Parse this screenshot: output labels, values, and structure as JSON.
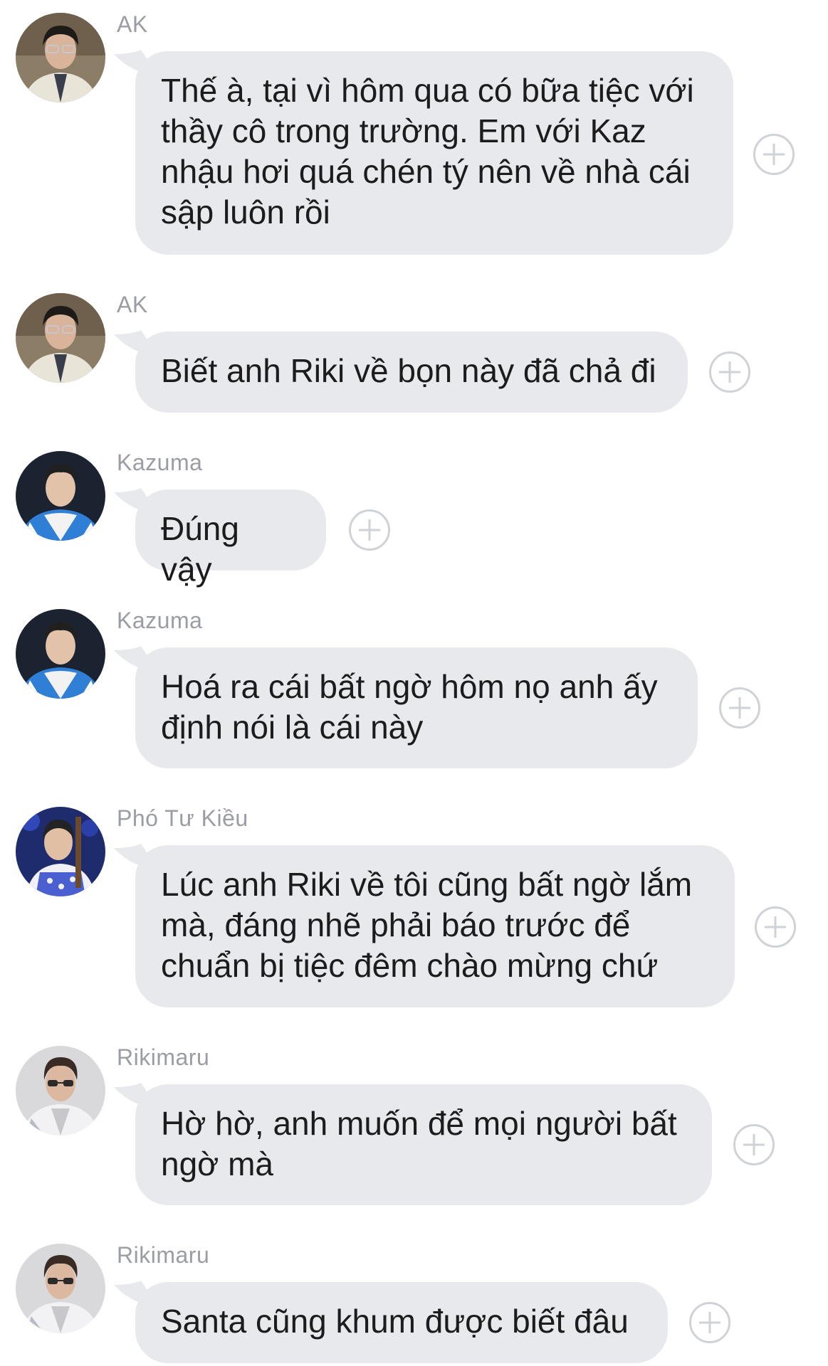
{
  "messages": [
    {
      "sender": "AK",
      "avatar_icon": "avatar-ak",
      "text": "Thế à, tại vì hôm qua có bữa tiệc với\nthầy cô trong trường. Em với Kaz\nnhậu hơi quá chén tý nên về nhà cái\nsập luôn rồi"
    },
    {
      "sender": "AK",
      "avatar_icon": "avatar-ak",
      "text": "Biết anh Riki về bọn này đã chả đi"
    },
    {
      "sender": "Kazuma",
      "avatar_icon": "avatar-kazuma",
      "text": "Đúng vậy"
    },
    {
      "sender": "Kazuma",
      "avatar_icon": "avatar-kazuma",
      "text": "Hoá ra cái bất ngờ hôm nọ anh ấy\nđịnh nói là cái này"
    },
    {
      "sender": "Phó Tư Kiều",
      "avatar_icon": "avatar-pho-tu-kieu",
      "text": "Lúc anh Riki về tôi cũng bất ngờ lắm\nmà, đáng nhẽ phải báo trước để\nchuẩn bị tiệc đêm chào mừng chứ"
    },
    {
      "sender": "Rikimaru",
      "avatar_icon": "avatar-rikimaru",
      "text": "Hờ hờ, anh muốn để mọi người bất\nngờ mà"
    },
    {
      "sender": "Rikimaru",
      "avatar_icon": "avatar-rikimaru",
      "text": "Santa cũng khum được biết đâu"
    }
  ],
  "add_reaction_icon": "plus-circle-icon",
  "colors": {
    "bubble": "#e7e9ec",
    "sender_text": "#9a9da3",
    "message_text": "#1c1c1e",
    "add_icon": "#cfd2d6"
  }
}
